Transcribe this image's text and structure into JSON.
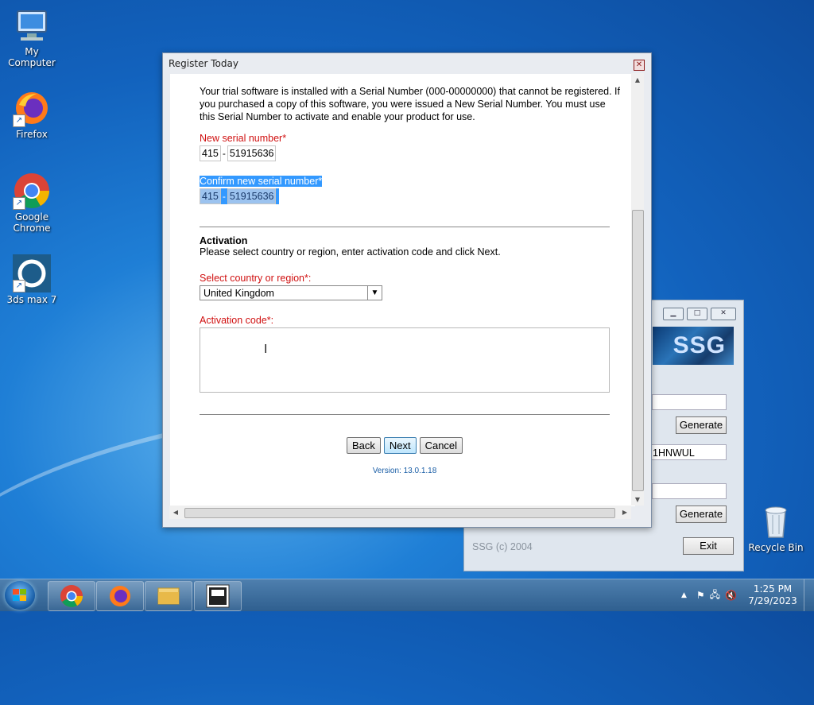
{
  "desktop": {
    "icons": [
      {
        "label": "My Computer",
        "icon": "computer-icon"
      },
      {
        "label": "Firefox",
        "icon": "firefox-icon"
      },
      {
        "label": "Google Chrome",
        "icon": "chrome-icon"
      },
      {
        "label": "3ds max 7",
        "icon": "3dsmax-icon"
      },
      {
        "label": "Recycle Bin",
        "icon": "recycle-bin-icon"
      }
    ]
  },
  "register_window": {
    "title": "Register Today",
    "intro": "Your trial software is installed with a Serial Number (000-00000000) that cannot be registered. If you purchased a copy of this software, you were issued a New Serial Number. You must use this Serial Number to activate and enable your product for use.",
    "new_serial_label": "New serial number*",
    "new_serial_prefix": "415",
    "new_serial_number": "51915636",
    "confirm_serial_label": "Confirm new serial number*",
    "confirm_serial_prefix": "415",
    "confirm_serial_number": "51915636",
    "serial_separator": "-",
    "activation_heading": "Activation",
    "activation_text": "Please select country or region, enter activation code and click Next.",
    "country_label": "Select country or region*:",
    "country_value": "United Kingdom",
    "activation_code_label": "Activation code*:",
    "activation_code_value": "",
    "back_label": "Back",
    "next_label": "Next",
    "cancel_label": "Cancel",
    "version": "Version: 13.0.1.18"
  },
  "ssg_window": {
    "logo_text": "SSG",
    "generate_label_1": "Generate",
    "request_code": "1HNWUL",
    "generate_label_2": "Generate",
    "status": "SSG (c) 2004",
    "exit_label": "Exit"
  },
  "taskbar": {
    "time": "1:25 PM",
    "date": "7/29/2023",
    "apps": [
      "chrome-icon",
      "firefox-icon",
      "explorer-icon",
      "keygen-icon"
    ]
  }
}
